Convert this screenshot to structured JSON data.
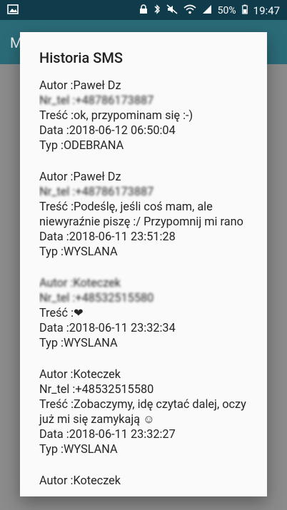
{
  "statusbar": {
    "battery": "50%",
    "time": "19:47",
    "icons": [
      "image-icon",
      "lock-icon",
      "bluetooth-icon",
      "mute-icon",
      "wifi-icon",
      "signal-icon",
      "battery-icon"
    ]
  },
  "appbar": {
    "title": "M"
  },
  "dialog": {
    "title": "Historia SMS",
    "entries": [
      {
        "autor": "Autor :Paweł Dz",
        "nr": "Nr_tel :+48786173887",
        "tresc": "Treść :ok, przypominam się :-)",
        "data": "Data :2018-06-12 06:50:04",
        "typ": "Typ :ODEBRANA"
      },
      {
        "autor": "Autor :Paweł Dz",
        "nr": "Nr_tel :+48786173887",
        "tresc": "Treść :Podeślę, jeśli coś mam, ale niewyraźnie piszę :/ Przypomnij mi rano",
        "data": "Data :2018-06-11 23:51:28",
        "typ": "Typ :WYSLANA"
      },
      {
        "autor": "Autor :Koteczek",
        "nr": "Nr_tel :+48532515580",
        "tresc": "Treść :❤",
        "data": "Data :2018-06-11 23:32:34",
        "typ": "Typ :WYSLANA"
      },
      {
        "autor": "Autor :Koteczek",
        "nr": "Nr_tel :+48532515580",
        "tresc": "Treść :Zobaczymy, idę czytać dalej, oczy już mi się zamykają ☺",
        "data": "Data :2018-06-11 23:32:27",
        "typ": "Typ :WYSLANA"
      },
      {
        "autor": "Autor :Koteczek"
      }
    ]
  }
}
